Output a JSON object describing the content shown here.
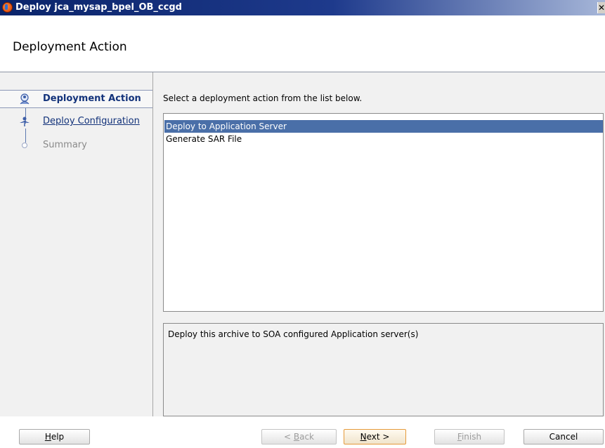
{
  "window": {
    "title": "Deploy jca_mysap_bpel_OB_ccgd",
    "close_glyph": "✕"
  },
  "header": {
    "title": "Deployment Action"
  },
  "steps": [
    {
      "label": "Deployment Action",
      "state": "current",
      "icon": "person-step-icon"
    },
    {
      "label": "Deploy Configuration",
      "state": "link",
      "icon": "person-step-icon"
    },
    {
      "label": "Summary",
      "state": "disabled",
      "icon": "empty-step-icon"
    }
  ],
  "content": {
    "instruction": "Select a deployment action from the list below.",
    "actions": [
      "Deploy to Application Server",
      "Generate SAR File"
    ],
    "selected_action": "Deploy to Application Server",
    "description": "Deploy this archive to SOA configured Application server(s)"
  },
  "buttons": {
    "help": {
      "mnemonic": "H",
      "rest": "elp"
    },
    "back": {
      "prefix": "< ",
      "mnemonic": "B",
      "rest": "ack"
    },
    "next": {
      "mnemonic": "N",
      "rest": "ext >"
    },
    "finish": {
      "mnemonic": "F",
      "rest": "inish"
    },
    "cancel": "Cancel"
  },
  "colors": {
    "titlebar": "#0a246a",
    "selection": "#4a6fa8",
    "link": "#12327a",
    "default_button_border": "#e59a3a"
  }
}
